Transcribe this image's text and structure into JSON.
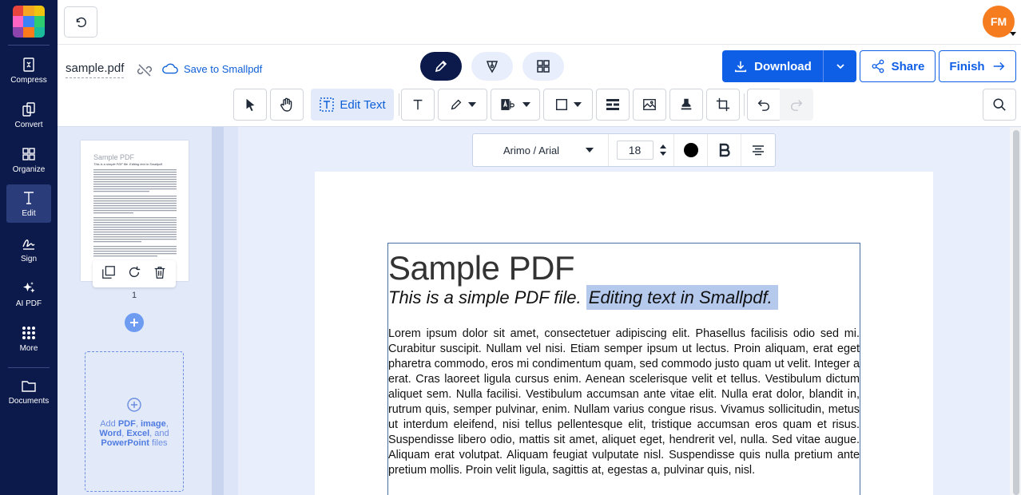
{
  "app": {
    "brand_colors": [
      "#e8453c",
      "#f5a623",
      "#2ecc71",
      "#3b82f6",
      "#8e44ad",
      "#ff66c4",
      "#f1c40f",
      "#1abc9c",
      "#ff7a1a"
    ]
  },
  "nav": {
    "items": [
      {
        "label": "Compress",
        "icon": "compress-icon"
      },
      {
        "label": "Convert",
        "icon": "convert-icon"
      },
      {
        "label": "Organize",
        "icon": "organize-icon"
      },
      {
        "label": "Edit",
        "icon": "edit-text-icon"
      },
      {
        "label": "Sign",
        "icon": "sign-icon"
      },
      {
        "label": "AI PDF",
        "icon": "ai-sparkle-icon"
      },
      {
        "label": "More",
        "icon": "grid-dots-icon"
      },
      {
        "label": "Documents",
        "icon": "folder-icon"
      }
    ]
  },
  "topbar": {
    "avatar_initials": "FM",
    "avatar_color": "#f57c1f"
  },
  "file": {
    "name": "sample.pdf",
    "save_label": "Save to Smallpdf"
  },
  "actions": {
    "download_label": "Download",
    "share_label": "Share",
    "finish_label": "Finish"
  },
  "tools": {
    "edit_text_label": "Edit Text"
  },
  "format": {
    "font": "Arimo / Arial",
    "size": "18",
    "color": "#000000"
  },
  "thumbnails": {
    "page_number": "1",
    "thumb_title": "Sample PDF",
    "thumb_subtitle": "This is a simple PDF file. Editing text in Smallpdf.",
    "dropzone": {
      "prefix": "Add ",
      "pdf": "PDF",
      "sep1": ", ",
      "image": "image",
      "sep2": ", ",
      "word": "Word",
      "sep3": ", ",
      "excel": "Excel",
      "sep4": ", and ",
      "powerpoint": "PowerPoint",
      "suffix": " files"
    }
  },
  "document": {
    "title": "Sample PDF",
    "subtitle_plain": "This is a simple PDF file. ",
    "subtitle_selected": "Editing text in Smallpdf.",
    "body": "Lorem ipsum dolor sit amet, consectetuer adipiscing elit. Phasellus facilisis odio sed mi. Curabitur suscipit. Nullam vel nisi. Etiam semper ipsum ut lectus. Proin aliquam, erat eget pharetra commodo, eros mi condimentum quam, sed commodo justo quam ut velit. Integer a erat. Cras laoreet ligula cursus enim. Aenean scelerisque velit et tellus. Vestibulum dictum aliquet sem. Nulla facilisi. Vestibulum accumsan ante vitae elit. Nulla erat dolor, blandit in, rutrum quis, semper pulvinar, enim. Nullam varius congue risus. Vivamus sollicitudin, metus ut interdum eleifend, nisi tellus pellentesque elit, tristique accumsan eros quam et risus. Suspendisse libero odio, mattis sit amet, aliquet eget, hendrerit vel, nulla. Sed vitae augue. Aliquam erat volutpat. Aliquam feugiat vulputate nisl. Suspendisse quis nulla pretium ante pretium mollis. Proin velit ligula, sagittis at, egestas a, pulvinar quis, nisl."
  }
}
